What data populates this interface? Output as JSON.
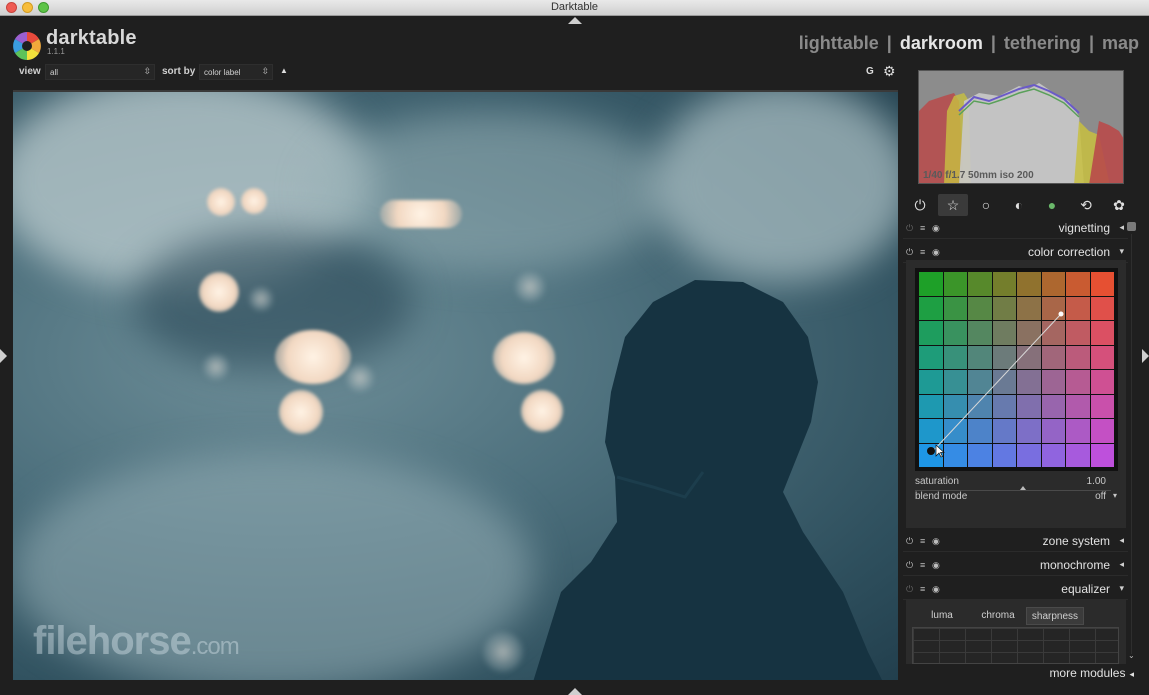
{
  "window": {
    "title": "Darktable"
  },
  "app": {
    "name": "darktable",
    "version": "1.1.1"
  },
  "views": [
    {
      "label": "lighttable",
      "active": false
    },
    {
      "label": "darkroom",
      "active": true
    },
    {
      "label": "tethering",
      "active": false
    },
    {
      "label": "map",
      "active": false
    }
  ],
  "view_separator": "|",
  "filter": {
    "view_label": "view",
    "view_value": "all",
    "sort_label": "sort by",
    "sort_value": "color label",
    "sort_dir": "▲",
    "grouping": "G",
    "settings_icon": "gear-icon"
  },
  "watermark": {
    "main": "filehorse",
    "suffix": ".com"
  },
  "histogram": {
    "info": "1/40 f/1.7 50mm iso 200"
  },
  "module_groups": [
    {
      "icon": "power-icon",
      "glyph": "⏻",
      "active": false
    },
    {
      "icon": "star-icon",
      "glyph": "☆",
      "active": true
    },
    {
      "icon": "circle-icon",
      "glyph": "○",
      "active": false
    },
    {
      "icon": "half-circle-icon",
      "glyph": "◐",
      "active": false
    },
    {
      "icon": "color-circle-icon",
      "glyph": "●",
      "active": false
    },
    {
      "icon": "correct-icon",
      "glyph": "⟲",
      "active": false
    },
    {
      "icon": "effect-icon",
      "glyph": "✿",
      "active": false
    }
  ],
  "modules": {
    "vignetting": {
      "name": "vignetting",
      "arrow": "◂"
    },
    "color_correction": {
      "name": "color correction",
      "arrow": "▾"
    },
    "zone_system": {
      "name": "zone system",
      "arrow": "◂"
    },
    "monochrome": {
      "name": "monochrome",
      "arrow": "◂"
    },
    "equalizer": {
      "name": "equalizer",
      "arrow": "▾"
    }
  },
  "color_correction": {
    "saturation_label": "saturation",
    "saturation_value": "1.00",
    "saturation_level": 0.55,
    "blend_label": "blend mode",
    "blend_value": "off",
    "blend_arrow": "▾"
  },
  "equalizer": {
    "tabs": [
      {
        "label": "luma",
        "active": false
      },
      {
        "label": "chroma",
        "active": false
      },
      {
        "label": "sharpness",
        "active": true
      }
    ]
  },
  "more_modules": {
    "label": "more modules",
    "arrow": "◂"
  },
  "colors": {
    "panel_bg": "#1f1f1f",
    "active_view": "#e6e6e6",
    "inactive_view": "#8a8a8a"
  }
}
